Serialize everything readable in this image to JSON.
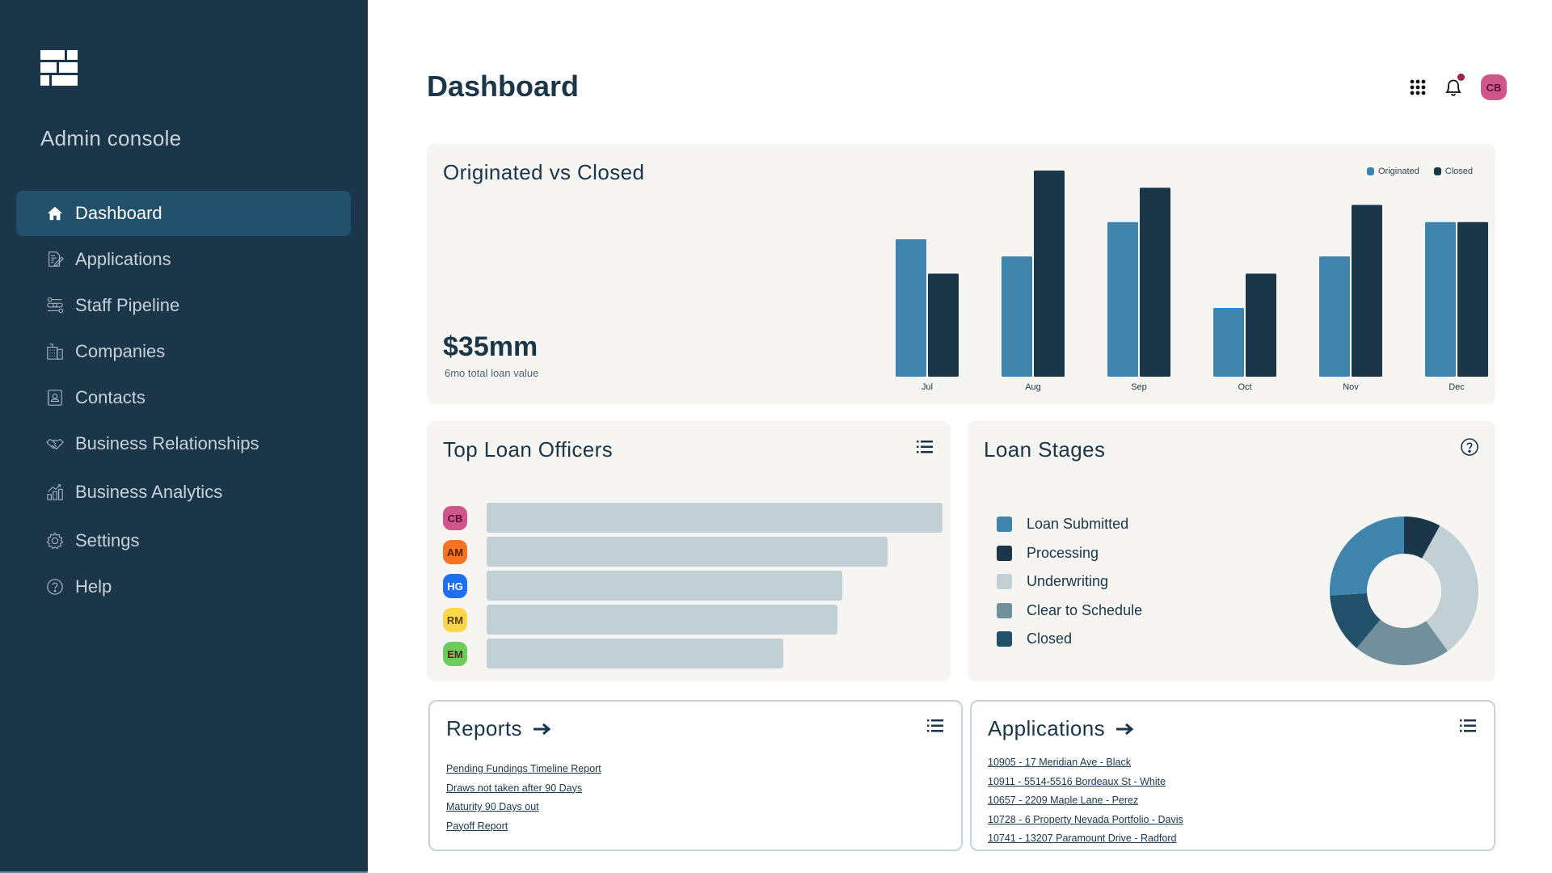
{
  "sidebar": {
    "title": "Admin console",
    "items": [
      {
        "label": "Dashboard",
        "icon": "home-icon",
        "active": true
      },
      {
        "label": "Applications",
        "icon": "document-edit-icon"
      },
      {
        "label": "Staff Pipeline",
        "icon": "pipeline-icon"
      },
      {
        "label": "Companies",
        "icon": "building-icon"
      },
      {
        "label": "Contacts",
        "icon": "contact-book-icon"
      },
      {
        "label": "Business Relationships",
        "icon": "handshake-icon"
      },
      {
        "label": "Business Analytics",
        "icon": "analytics-icon"
      },
      {
        "label": "Settings",
        "icon": "gear-icon"
      },
      {
        "label": "Help",
        "icon": "help-icon"
      }
    ]
  },
  "header": {
    "title": "Dashboard",
    "avatar_initials": "CB",
    "has_notification": true
  },
  "originated_vs_closed": {
    "title": "Originated vs Closed",
    "total_value": "$35mm",
    "total_label": "6mo total loan value"
  },
  "chart_data": [
    {
      "type": "bar",
      "title": "Originated vs Closed",
      "categories": [
        "Jul",
        "Aug",
        "Sep",
        "Oct",
        "Nov",
        "Dec"
      ],
      "series": [
        {
          "name": "Originated",
          "color": "#3e84ad",
          "values": [
            8,
            7,
            9,
            4,
            7,
            9
          ]
        },
        {
          "name": "Closed",
          "color": "#1b3549",
          "values": [
            6,
            12,
            11,
            6,
            10,
            9
          ]
        }
      ],
      "xlabel": "",
      "ylabel": "",
      "ylim": [
        0,
        12
      ],
      "grid": false,
      "legend": "top-right"
    },
    {
      "type": "bar",
      "orientation": "horizontal",
      "title": "Top Loan Officers",
      "categories": [
        "CB",
        "AM",
        "HG",
        "RM",
        "EM"
      ],
      "values": [
        100,
        88,
        78,
        77,
        65
      ],
      "ylim": [
        0,
        100
      ]
    },
    {
      "type": "pie",
      "donut": true,
      "title": "Loan Stages",
      "categories": [
        "Processing",
        "Underwriting",
        "Clear to Schedule",
        "Closed",
        "Loan Submitted"
      ],
      "values": [
        8,
        32,
        21,
        13,
        26
      ],
      "colors": [
        "#1b3549",
        "#c2d0d6",
        "#71909b",
        "#22506b",
        "#3e84ad"
      ],
      "legend": "left"
    }
  ],
  "top_loan_officers": {
    "title": "Top Loan Officers",
    "officers": [
      {
        "initials": "CB",
        "bg": "#d0558a",
        "fg": "#5a1030",
        "value": 100
      },
      {
        "initials": "AM",
        "bg": "#f57423",
        "fg": "#5a1e05",
        "value": 88
      },
      {
        "initials": "HG",
        "bg": "#1f6ff0",
        "fg": "#ffffff",
        "value": 78
      },
      {
        "initials": "RM",
        "bg": "#fcd74e",
        "fg": "#5a4305",
        "value": 77
      },
      {
        "initials": "EM",
        "bg": "#6ccc5c",
        "fg": "#5a1e20",
        "value": 65
      }
    ]
  },
  "loan_stages": {
    "title": "Loan Stages",
    "legend": [
      {
        "label": "Loan Submitted",
        "color": "#3e84ad"
      },
      {
        "label": "Processing",
        "color": "#1b3549"
      },
      {
        "label": "Underwriting",
        "color": "#c2d0d6"
      },
      {
        "label": "Clear to Schedule",
        "color": "#71909b"
      },
      {
        "label": "Closed",
        "color": "#22506b"
      }
    ]
  },
  "reports": {
    "title": "Reports",
    "links": [
      "Pending Fundings Timeline Report",
      "Draws not taken after 90 Days",
      "Maturity 90 Days out",
      "Payoff Report"
    ]
  },
  "applications": {
    "title": "Applications",
    "links": [
      "10905 - 17 Meridian Ave - Black",
      "10911 - 5514-5516 Bordeaux St - White",
      "10657 - 2209 Maple Lane - Perez",
      "10728 - 6 Property Nevada Portfolio - Davis",
      "10741 - 13207 Paramount Drive - Radford"
    ]
  }
}
